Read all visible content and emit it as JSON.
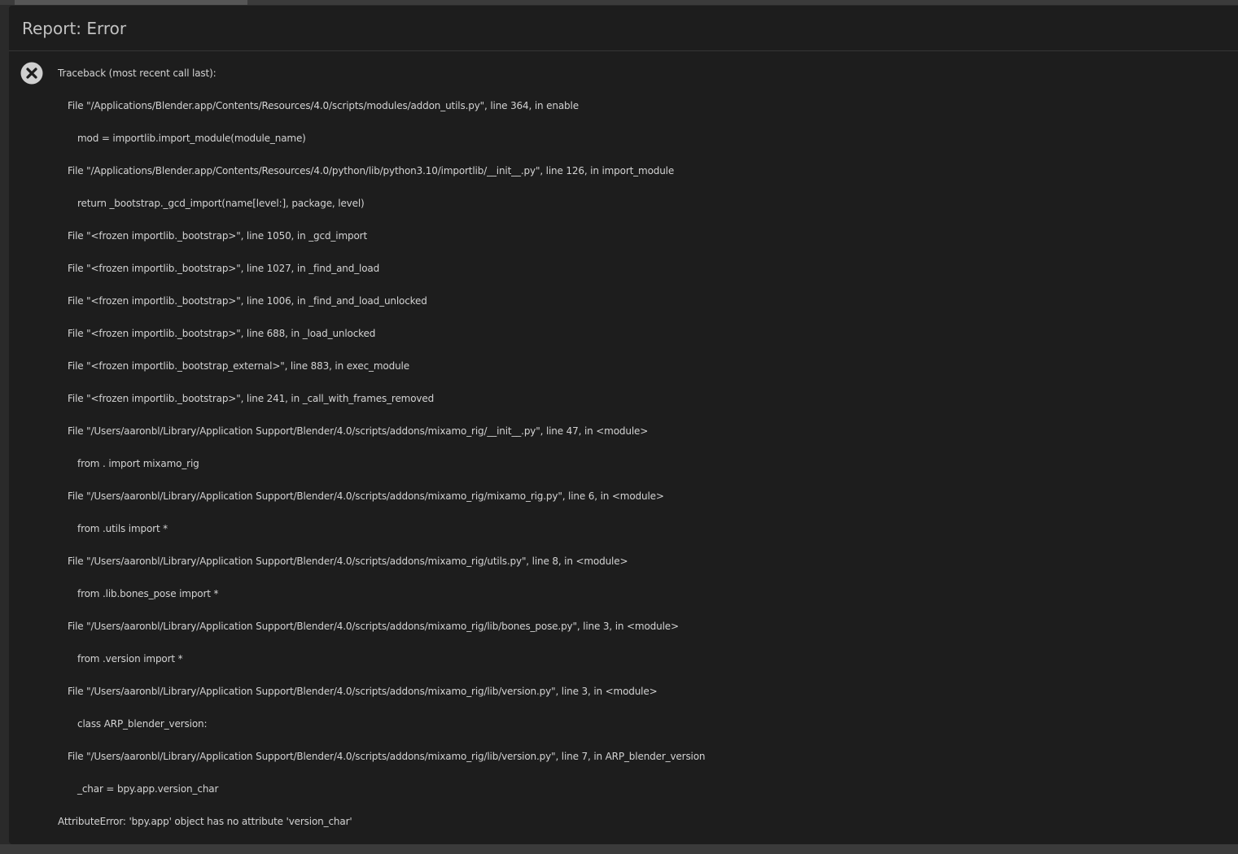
{
  "panel": {
    "title": "Report: Error"
  },
  "icons": {
    "error": "error-circle-x-icon"
  },
  "colors": {
    "background": "#1d1d1d",
    "text": "#d3d3d3",
    "icon": "#d0d0d0"
  },
  "traceback": [
    {
      "indent": 0,
      "text": "Traceback (most recent call last):"
    },
    {
      "indent": 1,
      "text": "File \"/Applications/Blender.app/Contents/Resources/4.0/scripts/modules/addon_utils.py\", line 364, in enable"
    },
    {
      "indent": 2,
      "text": "mod = importlib.import_module(module_name)"
    },
    {
      "indent": 1,
      "text": "File \"/Applications/Blender.app/Contents/Resources/4.0/python/lib/python3.10/importlib/__init__.py\", line 126, in import_module"
    },
    {
      "indent": 2,
      "text": "return _bootstrap._gcd_import(name[level:], package, level)"
    },
    {
      "indent": 1,
      "text": "File \"<frozen importlib._bootstrap>\", line 1050, in _gcd_import"
    },
    {
      "indent": 1,
      "text": "File \"<frozen importlib._bootstrap>\", line 1027, in _find_and_load"
    },
    {
      "indent": 1,
      "text": "File \"<frozen importlib._bootstrap>\", line 1006, in _find_and_load_unlocked"
    },
    {
      "indent": 1,
      "text": "File \"<frozen importlib._bootstrap>\", line 688, in _load_unlocked"
    },
    {
      "indent": 1,
      "text": "File \"<frozen importlib._bootstrap_external>\", line 883, in exec_module"
    },
    {
      "indent": 1,
      "text": "File \"<frozen importlib._bootstrap>\", line 241, in _call_with_frames_removed"
    },
    {
      "indent": 1,
      "text": "File \"/Users/aaronbl/Library/Application Support/Blender/4.0/scripts/addons/mixamo_rig/__init__.py\", line 47, in <module>"
    },
    {
      "indent": 2,
      "text": "from . import mixamo_rig"
    },
    {
      "indent": 1,
      "text": "File \"/Users/aaronbl/Library/Application Support/Blender/4.0/scripts/addons/mixamo_rig/mixamo_rig.py\", line 6, in <module>"
    },
    {
      "indent": 2,
      "text": "from .utils import *"
    },
    {
      "indent": 1,
      "text": "File \"/Users/aaronbl/Library/Application Support/Blender/4.0/scripts/addons/mixamo_rig/utils.py\", line 8, in <module>"
    },
    {
      "indent": 2,
      "text": "from .lib.bones_pose import *"
    },
    {
      "indent": 1,
      "text": "File \"/Users/aaronbl/Library/Application Support/Blender/4.0/scripts/addons/mixamo_rig/lib/bones_pose.py\", line 3, in <module>"
    },
    {
      "indent": 2,
      "text": "from .version import *"
    },
    {
      "indent": 1,
      "text": "File \"/Users/aaronbl/Library/Application Support/Blender/4.0/scripts/addons/mixamo_rig/lib/version.py\", line 3, in <module>"
    },
    {
      "indent": 2,
      "text": "class ARP_blender_version:"
    },
    {
      "indent": 1,
      "text": "File \"/Users/aaronbl/Library/Application Support/Blender/4.0/scripts/addons/mixamo_rig/lib/version.py\", line 7, in ARP_blender_version"
    },
    {
      "indent": 2,
      "text": "_char = bpy.app.version_char"
    },
    {
      "indent": 0,
      "text": "AttributeError: 'bpy.app' object has no attribute 'version_char'"
    }
  ]
}
